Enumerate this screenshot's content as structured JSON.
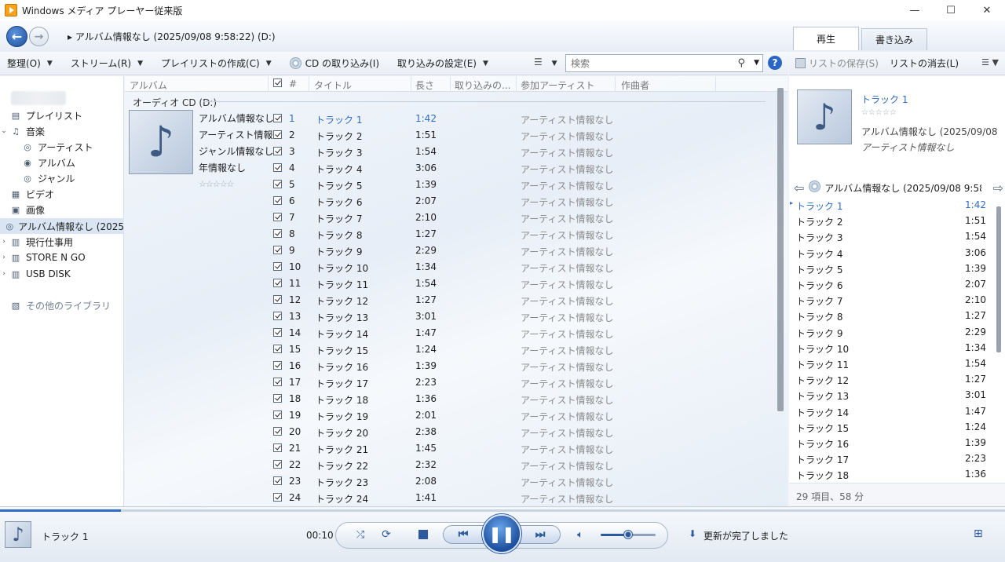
{
  "window": {
    "title": "Windows メディア プレーヤー従来版",
    "minimize": "—",
    "maximize": "☐",
    "close": "✕"
  },
  "nav": {
    "back": "←",
    "forward": "→",
    "breadcrumb_arrow": "▸",
    "breadcrumb": "アルバム情報なし (2025/09/08 9:58:22) (D:)"
  },
  "tabs": [
    {
      "label": "再生"
    },
    {
      "label": "書き込み"
    }
  ],
  "toolbar": {
    "organize": "整理(O)",
    "stream": "ストリーム(R)",
    "create_playlist": "プレイリストの作成(C)",
    "rip_cd": "CD の取り込み(I)",
    "rip_settings": "取り込みの設定(E)",
    "search_placeholder": "検索",
    "help": "?"
  },
  "right_toolbar": {
    "save_list": "リストの保存(S)",
    "clear_list": "リストの消去(L)"
  },
  "sidebar": {
    "items": [
      {
        "label": "プレイリスト"
      },
      {
        "label": "音楽"
      },
      {
        "label": "アーティスト"
      },
      {
        "label": "アルバム"
      },
      {
        "label": "ジャンル"
      },
      {
        "label": "ビデオ"
      },
      {
        "label": "画像"
      },
      {
        "label": "アルバム情報なし (2025"
      },
      {
        "label": "現行仕事用"
      },
      {
        "label": "STORE N GO"
      },
      {
        "label": "USB DISK"
      },
      {
        "label": "その他のライブラリ"
      }
    ]
  },
  "columns": {
    "album": "アルバム",
    "num": "#",
    "title": "タイトル",
    "length": "長さ",
    "rip_status": "取り込みの...",
    "artist": "参加アーティスト",
    "composer": "作曲者"
  },
  "group": {
    "title": "オーディオ CD (D:)",
    "album_name": "アルバム情報なし...",
    "artist_name": "アーティスト情報...",
    "genre": "ジャンル情報なし",
    "year": "年情報なし",
    "rating": "☆☆☆☆☆"
  },
  "tracks": [
    {
      "num": "1",
      "title": "トラック 1",
      "length": "1:42",
      "artist": "アーティスト情報なし"
    },
    {
      "num": "2",
      "title": "トラック 2",
      "length": "1:51",
      "artist": "アーティスト情報なし"
    },
    {
      "num": "3",
      "title": "トラック 3",
      "length": "1:54",
      "artist": "アーティスト情報なし"
    },
    {
      "num": "4",
      "title": "トラック 4",
      "length": "3:06",
      "artist": "アーティスト情報なし"
    },
    {
      "num": "5",
      "title": "トラック 5",
      "length": "1:39",
      "artist": "アーティスト情報なし"
    },
    {
      "num": "6",
      "title": "トラック 6",
      "length": "2:07",
      "artist": "アーティスト情報なし"
    },
    {
      "num": "7",
      "title": "トラック 7",
      "length": "2:10",
      "artist": "アーティスト情報なし"
    },
    {
      "num": "8",
      "title": "トラック 8",
      "length": "1:27",
      "artist": "アーティスト情報なし"
    },
    {
      "num": "9",
      "title": "トラック 9",
      "length": "2:29",
      "artist": "アーティスト情報なし"
    },
    {
      "num": "10",
      "title": "トラック 10",
      "length": "1:34",
      "artist": "アーティスト情報なし"
    },
    {
      "num": "11",
      "title": "トラック 11",
      "length": "1:54",
      "artist": "アーティスト情報なし"
    },
    {
      "num": "12",
      "title": "トラック 12",
      "length": "1:27",
      "artist": "アーティスト情報なし"
    },
    {
      "num": "13",
      "title": "トラック 13",
      "length": "3:01",
      "artist": "アーティスト情報なし"
    },
    {
      "num": "14",
      "title": "トラック 14",
      "length": "1:47",
      "artist": "アーティスト情報なし"
    },
    {
      "num": "15",
      "title": "トラック 15",
      "length": "1:24",
      "artist": "アーティスト情報なし"
    },
    {
      "num": "16",
      "title": "トラック 16",
      "length": "1:39",
      "artist": "アーティスト情報なし"
    },
    {
      "num": "17",
      "title": "トラック 17",
      "length": "2:23",
      "artist": "アーティスト情報なし"
    },
    {
      "num": "18",
      "title": "トラック 18",
      "length": "1:36",
      "artist": "アーティスト情報なし"
    },
    {
      "num": "19",
      "title": "トラック 19",
      "length": "2:01",
      "artist": "アーティスト情報なし"
    },
    {
      "num": "20",
      "title": "トラック 20",
      "length": "2:38",
      "artist": "アーティスト情報なし"
    },
    {
      "num": "21",
      "title": "トラック 21",
      "length": "1:45",
      "artist": "アーティスト情報なし"
    },
    {
      "num": "22",
      "title": "トラック 22",
      "length": "2:32",
      "artist": "アーティスト情報なし"
    },
    {
      "num": "23",
      "title": "トラック 23",
      "length": "2:08",
      "artist": "アーティスト情報なし"
    },
    {
      "num": "24",
      "title": "トラック 24",
      "length": "1:41",
      "artist": "アーティスト情報なし"
    }
  ],
  "now_playing": {
    "title": "トラック 1",
    "rating": "☆☆☆☆☆",
    "album": "アルバム情報なし (2025/09/08 9:5...",
    "artist": "アーティスト情報なし"
  },
  "playlist": {
    "title": "アルバム情報なし (2025/09/08 9:58:...",
    "items": [
      {
        "name": "トラック 1",
        "length": "1:42"
      },
      {
        "name": "トラック 2",
        "length": "1:51"
      },
      {
        "name": "トラック 3",
        "length": "1:54"
      },
      {
        "name": "トラック 4",
        "length": "3:06"
      },
      {
        "name": "トラック 5",
        "length": "1:39"
      },
      {
        "name": "トラック 6",
        "length": "2:07"
      },
      {
        "name": "トラック 7",
        "length": "2:10"
      },
      {
        "name": "トラック 8",
        "length": "1:27"
      },
      {
        "name": "トラック 9",
        "length": "2:29"
      },
      {
        "name": "トラック 10",
        "length": "1:34"
      },
      {
        "name": "トラック 11",
        "length": "1:54"
      },
      {
        "name": "トラック 12",
        "length": "1:27"
      },
      {
        "name": "トラック 13",
        "length": "3:01"
      },
      {
        "name": "トラック 14",
        "length": "1:47"
      },
      {
        "name": "トラック 15",
        "length": "1:24"
      },
      {
        "name": "トラック 16",
        "length": "1:39"
      },
      {
        "name": "トラック 17",
        "length": "2:23"
      },
      {
        "name": "トラック 18",
        "length": "1:36"
      }
    ],
    "count": "29 項目、58 分"
  },
  "player": {
    "current_track": "トラック 1",
    "time": "00:10",
    "seek_fraction": 0.12,
    "volume_fraction": 0.5,
    "status": "更新が完了しました"
  },
  "colors": {
    "accent": "#2f6bc4",
    "playing_text": "#2f6bc4",
    "muted_text": "#8a8a8a"
  }
}
